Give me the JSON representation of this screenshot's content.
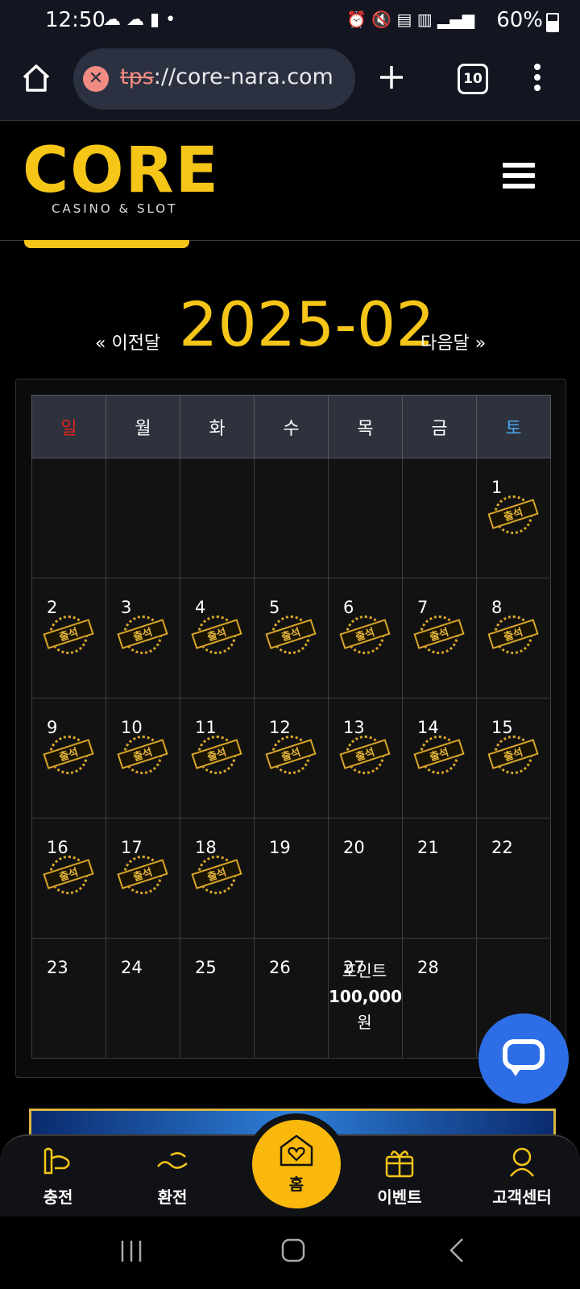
{
  "status_bar": {
    "time": "12:50",
    "battery": "60%"
  },
  "browser": {
    "url_prefix": "tps",
    "url_rest": "://core-nara.com",
    "tab_count": "10"
  },
  "site": {
    "logo_text": "CORE",
    "logo_subtitle": "CASINO & SLOT",
    "accent_color": "#f5c518"
  },
  "calendar": {
    "month": "2025-02",
    "prev_label": "« 이전달",
    "next_label": "다음달 »",
    "weekdays": [
      "일",
      "월",
      "화",
      "수",
      "목",
      "금",
      "토"
    ],
    "stamp_text": "출석",
    "reward": {
      "line1": "포인트",
      "line2": "100,000",
      "line3": "원"
    },
    "weeks": [
      [
        "",
        "",
        "",
        "",
        "",
        "",
        "1"
      ],
      [
        "2",
        "3",
        "4",
        "5",
        "6",
        "7",
        "8"
      ],
      [
        "9",
        "10",
        "11",
        "12",
        "13",
        "14",
        "15"
      ],
      [
        "16",
        "17",
        "18",
        "19",
        "20",
        "21",
        "22"
      ],
      [
        "23",
        "24",
        "25",
        "26",
        "27",
        "28",
        ""
      ]
    ],
    "attended_days": [
      1,
      2,
      3,
      4,
      5,
      6,
      7,
      8,
      9,
      10,
      11,
      12,
      13,
      14,
      15,
      16,
      17,
      18
    ],
    "reward_day": 27
  },
  "bottom_nav": {
    "items": [
      {
        "label": "충전",
        "icon": "deposit-icon"
      },
      {
        "label": "환전",
        "icon": "withdraw-icon"
      },
      {
        "label": "홈",
        "icon": "home-heart-icon"
      },
      {
        "label": "이벤트",
        "icon": "gift-icon"
      },
      {
        "label": "고객센터",
        "icon": "support-agent-icon"
      }
    ]
  }
}
